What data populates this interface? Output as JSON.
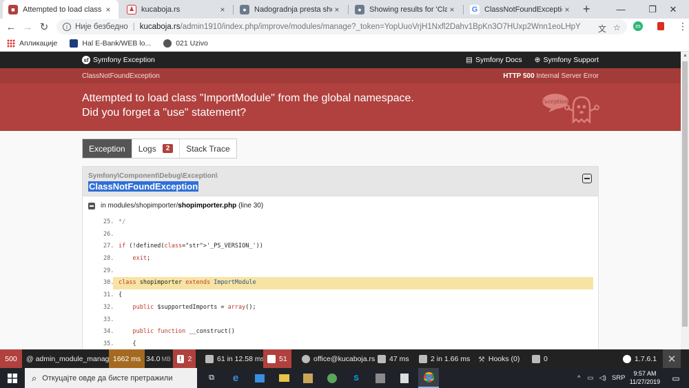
{
  "browser": {
    "tabs": [
      {
        "title": "Attempted to load class \"Impo",
        "icon": "symfony-error-icon",
        "active": true
      },
      {
        "title": "kucaboja.rs",
        "icon": "site-icon",
        "active": false
      },
      {
        "title": "Nadogradnja presta shopa sa",
        "icon": "forum-icon",
        "active": false
      },
      {
        "title": "Showing results for 'ClassNot",
        "icon": "forum-icon",
        "active": false
      },
      {
        "title": "ClassNotFoundException - Go",
        "icon": "google-icon",
        "active": false
      }
    ],
    "close_glyph": "×",
    "new_tab_glyph": "+",
    "window_controls": {
      "minimize": "—",
      "maximize": "❐",
      "close": "✕"
    },
    "address": {
      "security_label": "Није безбедно",
      "host": "kucaboja.rs",
      "path": "/admin1910/index.php/improve/modules/manage?_token=YopUuoVrjH1Nxfl2Dahv1BpKn3O7HUxp2Wnn1eoLHpY"
    },
    "bookmarks": [
      {
        "label": "Апликације",
        "icon": "apps-grid-icon"
      },
      {
        "label": "Hal E-Bank/WEB lo...",
        "icon": "bank-icon"
      },
      {
        "label": "021 Uzivo",
        "icon": "globe-icon"
      }
    ],
    "profile_initial": "m"
  },
  "symfony": {
    "top": {
      "brand": "Symfony Exception",
      "docs": "Symfony Docs",
      "support": "Symfony Support"
    },
    "header": {
      "exception_class": "ClassNotFoundException",
      "http_code": "HTTP 500",
      "http_text": "Internal Server Error",
      "message_line1": "Attempted to load class \"ImportModule\" from the global namespace.",
      "message_line2": "Did you forget a \"use\" statement?",
      "ghost_text": "Exception!"
    },
    "tabs": [
      {
        "label": "Exception",
        "active": true
      },
      {
        "label": "Logs",
        "badge": "2"
      },
      {
        "label": "Stack Trace"
      }
    ],
    "trace": {
      "namespace": "Symfony\\Component\\Debug\\Exception\\",
      "class": "ClassNotFoundException",
      "file_prefix": "in modules/shopimporter/",
      "file_name": "shopimporter.php",
      "line_info": "(line 30)",
      "code_lines": [
        {
          "n": "25.",
          "code": "*/"
        },
        {
          "n": "26.",
          "code": ""
        },
        {
          "n": "27.",
          "code": "if (!defined('_PS_VERSION_'))"
        },
        {
          "n": "28.",
          "code": "    exit;"
        },
        {
          "n": "29.",
          "code": ""
        },
        {
          "n": "30.",
          "code": "class shopimporter extends ImportModule",
          "highlight": true
        },
        {
          "n": "31.",
          "code": "{"
        },
        {
          "n": "32.",
          "code": "    public $supportedImports = array();"
        },
        {
          "n": "33.",
          "code": ""
        },
        {
          "n": "34.",
          "code": "    public function __construct()"
        },
        {
          "n": "35.",
          "code": "    {"
        }
      ]
    }
  },
  "debug_toolbar": {
    "status": "500",
    "route": "@ admin_module_manage",
    "time": "1662 ms",
    "memory": "34.0",
    "memory_unit": "MB",
    "errors": "2",
    "queries": "61 in 12.58 ms",
    "translations": "51",
    "user": "office@kucaboja.rs",
    "perf": "47 ms",
    "cache": "2 in 1.66 ms",
    "hooks": "Hooks (0)",
    "extra": "0",
    "version": "1.7.6.1",
    "close_glyph": "✕"
  },
  "taskbar": {
    "search_placeholder": "Откуцајте овде да бисте претражили",
    "language": "SRP",
    "time": "9:57 AM",
    "date": "11/27/2019"
  },
  "colors": {
    "symfony_red": "#b0413e",
    "symfony_dark": "#222222",
    "highlight": "#f7e4a4",
    "selection": "#2f6fd8"
  }
}
